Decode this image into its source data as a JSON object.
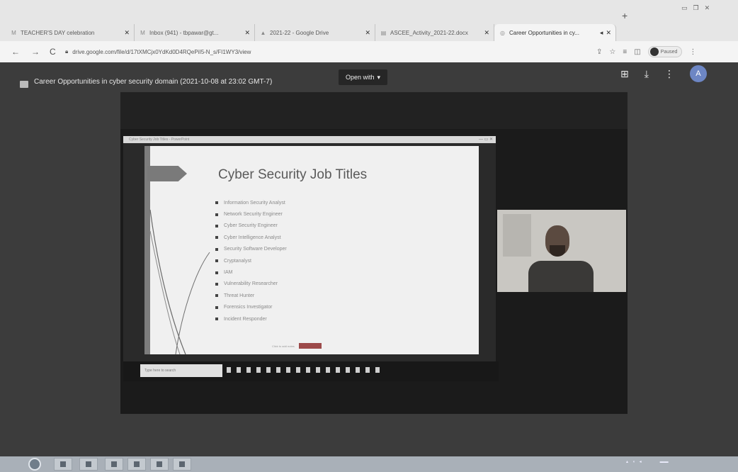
{
  "browser": {
    "tabs": [
      {
        "label": "TEACHER'S DAY celebration",
        "icon": "M",
        "active": false
      },
      {
        "label": "Inbox (941) - tbpawar@gt...",
        "icon": "M",
        "active": false
      },
      {
        "label": "2021-22 - Google Drive",
        "icon": "▲",
        "active": false
      },
      {
        "label": "ASCEE_Activity_2021-22.docx",
        "icon": "▤",
        "active": false
      },
      {
        "label": "Career Opportunities in cy...",
        "icon": "◎",
        "active": true
      }
    ],
    "address": "drive.google.com/file/d/17tXMCjx0YdKd0D4RQePiI5-N_s/FI1WY3/view",
    "profile_label": "Paused"
  },
  "viewer": {
    "file_title": "Career Opportunities in cyber security domain (2021-10-08 at 23:02 GMT-7)",
    "open_with_label": "Open with",
    "avatar_letter": "A"
  },
  "slide": {
    "titlebar_text": "Cyber Security Job Titles - PowerPoint",
    "title": "Cyber Security Job Titles",
    "bullets": [
      "Information Security Analyst",
      "Network Security Engineer",
      "Cyber Security Engineer",
      "Cyber Intelligence Analyst",
      "Security Software Developer",
      "Cryptanalyst",
      "IAM",
      "Vulnerability Researcher",
      "Threat Hunter",
      "Forensics Investigator",
      "Incident Responder"
    ],
    "footer_text": "Click to add notes",
    "search_placeholder": "Type here to search"
  },
  "colors": {
    "viewer_bg": "#3c3c3c",
    "slide_bg": "#f0f0f0",
    "accent_arrow": "#7a7a7a",
    "avatar": "#6d86c4"
  }
}
